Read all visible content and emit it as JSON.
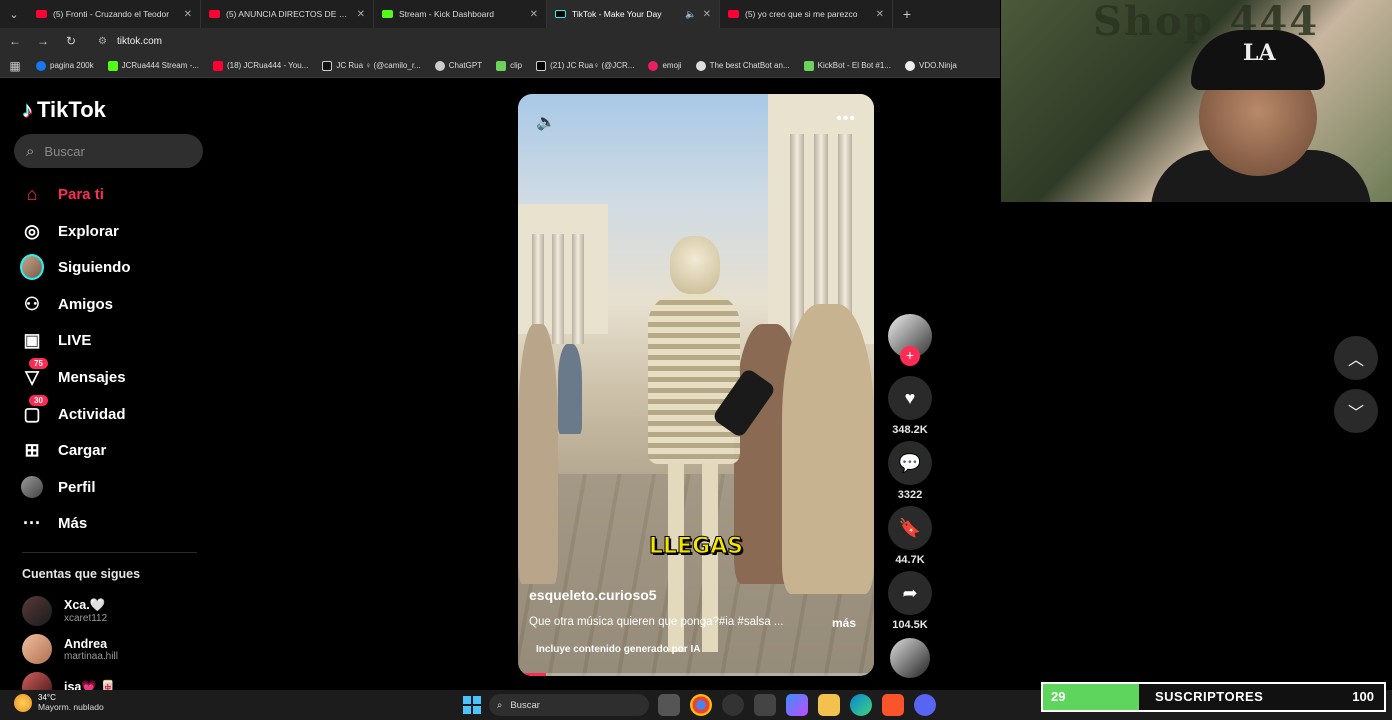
{
  "browser": {
    "tabs": [
      {
        "title": "(5) Fronti - Cruzando el Teodor",
        "favicon": "youtube-icon"
      },
      {
        "title": "(5) ANUNCIA DIRECTOS DE KIC",
        "favicon": "youtube-icon"
      },
      {
        "title": "Stream - Kick Dashboard",
        "favicon": "kick-icon"
      },
      {
        "title": "TikTok - Make Your Day",
        "favicon": "tiktok-icon",
        "active": true
      },
      {
        "title": "(5) yo creo que si me parezco",
        "favicon": "youtube-icon"
      }
    ],
    "url": "tiktok.com",
    "bookmarks": [
      {
        "label": "pagina 200k",
        "icon": "facebook-icon"
      },
      {
        "label": "JCRua444 Stream -...",
        "icon": "kick-icon"
      },
      {
        "label": "(18) JCRua444 - You...",
        "icon": "youtube-icon"
      },
      {
        "label": "JC Rua ♀ (@camilo_r...",
        "icon": "tiktok-icon"
      },
      {
        "label": "ChatGPT",
        "icon": "chatgpt-icon"
      },
      {
        "label": "clip",
        "icon": "clip-icon"
      },
      {
        "label": "(21) JC Rua♀ (@JCR...",
        "icon": "x-icon"
      },
      {
        "label": "emoji",
        "icon": "emoji-icon"
      },
      {
        "label": "The best ChatBot an...",
        "icon": "chatbot-icon"
      },
      {
        "label": "KickBot - El Bot #1...",
        "icon": "kickbot-icon"
      },
      {
        "label": "VDO.Ninja",
        "icon": "vdo-ninja-icon"
      }
    ]
  },
  "tiktok": {
    "logo": "TikTok",
    "search_placeholder": "Buscar",
    "nav": [
      {
        "label": "Para ti",
        "icon": "home-icon",
        "active": true
      },
      {
        "label": "Explorar",
        "icon": "compass-icon"
      },
      {
        "label": "Siguiendo",
        "icon": "following-avatar-icon"
      },
      {
        "label": "Amigos",
        "icon": "friends-icon"
      },
      {
        "label": "LIVE",
        "icon": "live-icon"
      },
      {
        "label": "Mensajes",
        "icon": "messages-icon",
        "badge": "75"
      },
      {
        "label": "Actividad",
        "icon": "activity-icon",
        "badge": "30"
      },
      {
        "label": "Cargar",
        "icon": "upload-icon"
      },
      {
        "label": "Perfil",
        "icon": "profile-avatar-icon"
      },
      {
        "label": "Más",
        "icon": "more-icon"
      }
    ],
    "following_title": "Cuentas que sigues",
    "following": [
      {
        "name": "Xca.🤍",
        "handle": "xcaret112"
      },
      {
        "name": "Andrea",
        "handle": "martinaa.hill"
      },
      {
        "name": "isa💗 🀄",
        "handle": ""
      }
    ],
    "video": {
      "overlay_text": "LLEGAS",
      "username": "esqueleto.curioso5",
      "description": "Que otra música quieren que ponga?#ia #salsa ...",
      "more_label": "más",
      "ai_label": "Incluye contenido generado por IA",
      "progress": 0.08
    },
    "actions": {
      "likes": "348.2K",
      "comments": "3322",
      "saves": "44.7K",
      "shares": "104.5K"
    }
  },
  "webcam": {
    "wall_text": "Shop 444",
    "cap_logo": "LA"
  },
  "taskbar": {
    "weather_temp": "34°C",
    "weather_desc": "Mayorm. nublado",
    "search_label": "Buscar"
  },
  "overlay": {
    "subs_count": "29",
    "subs_label": "SUSCRIPTORES",
    "subs_goal": "100"
  }
}
